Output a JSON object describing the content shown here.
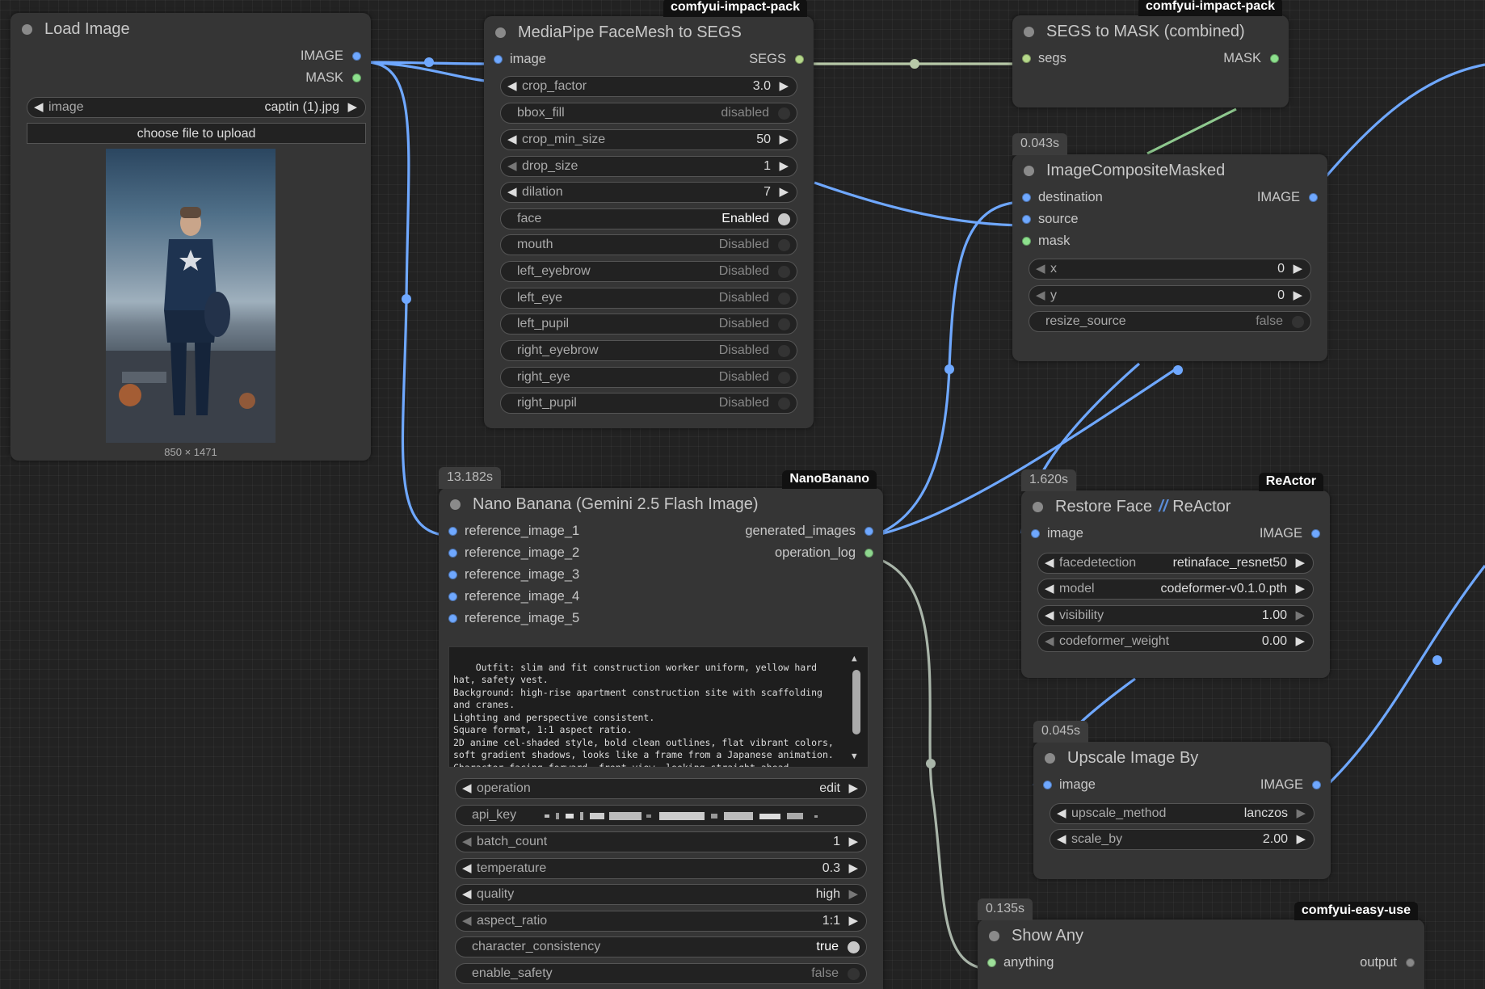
{
  "colors": {
    "image_link": "#6fa8ff",
    "mask_link": "#8fc98f",
    "segs_link": "#b8c9a8",
    "string_link": "#a9b5a9"
  },
  "nodes": {
    "load_image": {
      "title": "Load Image",
      "outputs": [
        "IMAGE",
        "MASK"
      ],
      "image_widget": {
        "label": "image",
        "value": "captin (1).jpg"
      },
      "upload_button": "choose file to upload",
      "caption": "850 × 1471"
    },
    "facemesh": {
      "badge": "comfyui-impact-pack",
      "title": "MediaPipe FaceMesh to SEGS",
      "input": "image",
      "output": "SEGS",
      "widgets": [
        {
          "label": "crop_factor",
          "value": "3.0"
        },
        {
          "label": "bbox_fill",
          "value": "disabled"
        },
        {
          "label": "crop_min_size",
          "value": "50"
        },
        {
          "label": "drop_size",
          "value": "1"
        },
        {
          "label": "dilation",
          "value": "7"
        },
        {
          "label": "face",
          "value": "Enabled"
        },
        {
          "label": "mouth",
          "value": "Disabled"
        },
        {
          "label": "left_eyebrow",
          "value": "Disabled"
        },
        {
          "label": "left_eye",
          "value": "Disabled"
        },
        {
          "label": "left_pupil",
          "value": "Disabled"
        },
        {
          "label": "right_eyebrow",
          "value": "Disabled"
        },
        {
          "label": "right_eye",
          "value": "Disabled"
        },
        {
          "label": "right_pupil",
          "value": "Disabled"
        }
      ]
    },
    "segs_to_mask": {
      "badge": "comfyui-impact-pack",
      "title": "SEGS to MASK (combined)",
      "input": "segs",
      "output": "MASK"
    },
    "composite": {
      "timing": "0.043s",
      "title": "ImageCompositeMasked",
      "inputs": [
        "destination",
        "source",
        "mask"
      ],
      "output": "IMAGE",
      "widgets": [
        {
          "label": "x",
          "value": "0"
        },
        {
          "label": "y",
          "value": "0"
        },
        {
          "label": "resize_source",
          "value": "false"
        }
      ]
    },
    "nano_banana": {
      "timing": "13.182s",
      "badge": "NanoBanano",
      "title": "Nano Banana (Gemini 2.5 Flash Image)",
      "inputs": [
        "reference_image_1",
        "reference_image_2",
        "reference_image_3",
        "reference_image_4",
        "reference_image_5"
      ],
      "outputs": [
        "generated_images",
        "operation_log"
      ],
      "prompt": "Outfit: slim and fit construction worker uniform, yellow hard hat, safety vest.\nBackground: high-rise apartment construction site with scaffolding and cranes.\nLighting and perspective consistent.\nSquare format, 1:1 aspect ratio.\n2D anime cel-shaded style, bold clean outlines, flat vibrant colors, soft gradient shadows, looks like a frame from a Japanese animation.\nCharacter facing forward, front view, looking straight ahead, centered",
      "widgets": [
        {
          "label": "operation",
          "value": "edit"
        },
        {
          "label": "api_key",
          "value": ""
        },
        {
          "label": "batch_count",
          "value": "1"
        },
        {
          "label": "temperature",
          "value": "0.3"
        },
        {
          "label": "quality",
          "value": "high"
        },
        {
          "label": "aspect_ratio",
          "value": "1:1"
        },
        {
          "label": "character_consistency",
          "value": "true"
        },
        {
          "label": "enable_safety",
          "value": "false"
        }
      ]
    },
    "restore_face": {
      "timing": "1.620s",
      "badge": "ReActor",
      "title": "Restore Face",
      "title_suffix": "ReActor",
      "input": "image",
      "output": "IMAGE",
      "widgets": [
        {
          "label": "facedetection",
          "value": "retinaface_resnet50"
        },
        {
          "label": "model",
          "value": "codeformer-v0.1.0.pth"
        },
        {
          "label": "visibility",
          "value": "1.00"
        },
        {
          "label": "codeformer_weight",
          "value": "0.00"
        }
      ]
    },
    "upscale": {
      "timing": "0.045s",
      "title": "Upscale Image By",
      "input": "image",
      "output": "IMAGE",
      "widgets": [
        {
          "label": "upscale_method",
          "value": "lanczos"
        },
        {
          "label": "scale_by",
          "value": "2.00"
        }
      ]
    },
    "show_any": {
      "timing": "0.135s",
      "badge": "comfyui-easy-use",
      "title": "Show Any",
      "input": "anything",
      "output": "output"
    }
  }
}
